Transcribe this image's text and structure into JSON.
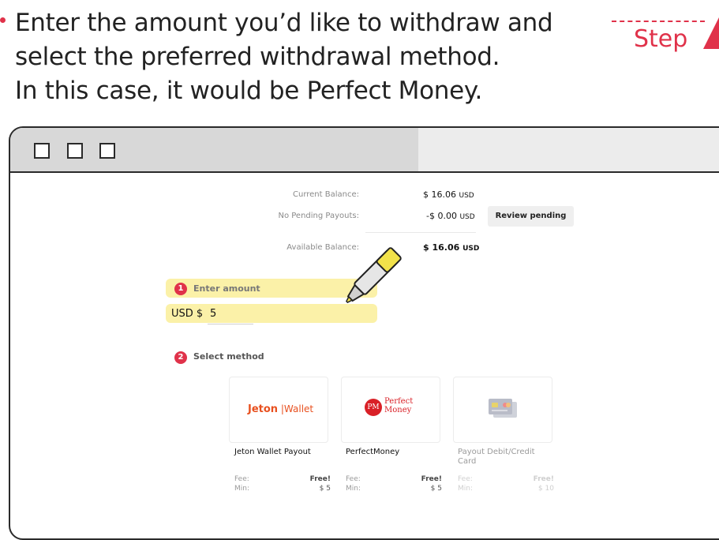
{
  "instruction": {
    "lines": [
      "Enter the amount you’d like to withdraw and",
      "select the preferred withdrawal method.",
      "In this case, it would be Perfect Money."
    ],
    "step_label": "Step"
  },
  "balance": {
    "current_label": "Current Balance:",
    "current_value": "$ 16.06",
    "current_unit": "USD",
    "pending_label": "No Pending Payouts:",
    "pending_value": "-$ 0.00",
    "pending_unit": "USD",
    "review_button": "Review pending",
    "available_label": "Available Balance:",
    "available_value": "$ 16.06",
    "available_unit": "USD"
  },
  "steps": {
    "enter_amount": {
      "number": "1",
      "label": "Enter amount",
      "currency_prefix": "USD $",
      "amount_value": "5"
    },
    "select_method": {
      "number": "2",
      "label": "Select method"
    }
  },
  "methods": [
    {
      "logo_text_a": "Jeton",
      "logo_text_b": "Wallet",
      "name": "Jeton Wallet Payout",
      "fee_label": "Fee:",
      "fee_value": "Free!",
      "min_label": "Min:",
      "min_value": "$ 5"
    },
    {
      "logo_badge": "PM",
      "logo_text_a": "Perfect",
      "logo_text_b": "Money",
      "name": "PerfectMoney",
      "fee_label": "Fee:",
      "fee_value": "Free!",
      "min_label": "Min:",
      "min_value": "$ 5"
    },
    {
      "name": "Payout Debit/Credit Card",
      "fee_label": "Fee:",
      "fee_value": "Free!",
      "min_label": "Min:",
      "min_value": "$ 10"
    }
  ],
  "colors": {
    "accent": "#e0324a",
    "highlight": "#fbf09e",
    "jeton": "#e8501f",
    "pm_red": "#d92027"
  }
}
